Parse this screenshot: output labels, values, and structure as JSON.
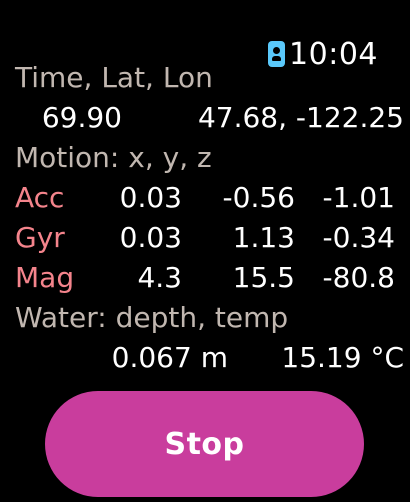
{
  "status": {
    "time": "10:04",
    "badge_icon": "person-badge-icon"
  },
  "location": {
    "header": "Time, Lat, Lon",
    "time_value": "69.90",
    "latlon_value": "47.68, -122.25"
  },
  "motion": {
    "header": "Motion: x, y, z",
    "rows": [
      {
        "label": "Acc",
        "x": "0.03",
        "y": "-0.56",
        "z": "-1.01"
      },
      {
        "label": "Gyr",
        "x": "0.03",
        "y": "1.13",
        "z": "-0.34"
      },
      {
        "label": "Mag",
        "x": "4.3",
        "y": "15.5",
        "z": "-80.8"
      }
    ]
  },
  "water": {
    "header": "Water: depth, temp",
    "depth": "0.067 m",
    "temp": "15.19 °C"
  },
  "button": {
    "label": "Stop"
  },
  "colors": {
    "background": "#000000",
    "header_text": "#c1b7b0",
    "row_label": "#f4848c",
    "button_bg": "#c93d9d",
    "badge": "#5ac8fa"
  }
}
